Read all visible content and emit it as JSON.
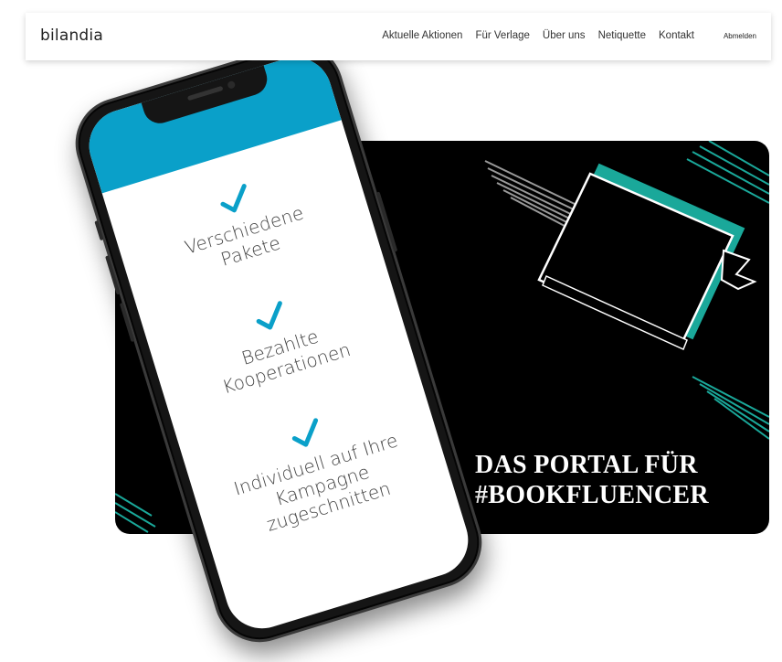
{
  "header": {
    "logo": "bilandia",
    "nav": [
      {
        "label": "Aktuelle Aktionen"
      },
      {
        "label": "Für Verlage"
      },
      {
        "label": "Über uns"
      },
      {
        "label": "Netiquette"
      },
      {
        "label": "Kontakt"
      }
    ],
    "logout_label": "Abmelden"
  },
  "promo": {
    "headline_line1": "DAS PORTAL FÜR",
    "headline_line2": "#BOOKFLUENCER"
  },
  "phone": {
    "features": [
      {
        "line1": "Verschiedene",
        "line2": "Pakete",
        "line3": ""
      },
      {
        "line1": "Bezahlte",
        "line2": "Kooperationen",
        "line3": ""
      },
      {
        "line1": "Individuell auf Ihre",
        "line2": "Kampagne",
        "line3": "zugeschnitten"
      }
    ]
  },
  "colors": {
    "accent_blue": "#0aa0c9",
    "teal": "#1aa89a",
    "card_background": "#000000"
  },
  "icons": {
    "check": "check-icon",
    "book": "book-icon"
  }
}
